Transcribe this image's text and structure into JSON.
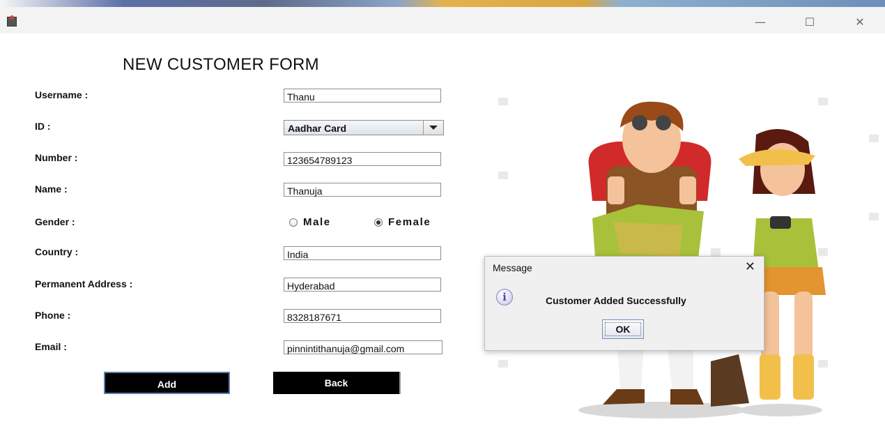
{
  "window": {
    "minimize_glyph": "—",
    "maximize_glyph": "☐",
    "close_glyph": "✕"
  },
  "form": {
    "title": "NEW CUSTOMER FORM",
    "labels": {
      "username": "Username :",
      "id": "ID :",
      "number": "Number :",
      "name": "Name :",
      "gender": "Gender :",
      "country": "Country :",
      "address": "Permanent Address :",
      "phone": "Phone :",
      "email": "Email :"
    },
    "values": {
      "username": "Thanu",
      "id": "Aadhar Card",
      "number": "123654789123",
      "name": "Thanuja",
      "country": "India",
      "address": "Hyderabad",
      "phone": "8328187671",
      "email": "pinnintithanuja@gmail.com"
    },
    "gender_options": {
      "male": "Male",
      "female": "Female",
      "selected": "Female"
    },
    "buttons": {
      "add": "Add",
      "back": "Back"
    }
  },
  "dialog": {
    "title": "Message",
    "close_glyph": "✕",
    "icon": "info-icon",
    "icon_glyph": "i",
    "message": "Customer Added Successfully",
    "ok": "OK"
  },
  "colors": {
    "button_bg": "#000000",
    "button_text": "#ffffff",
    "dialog_bg": "#f0f0f0"
  }
}
